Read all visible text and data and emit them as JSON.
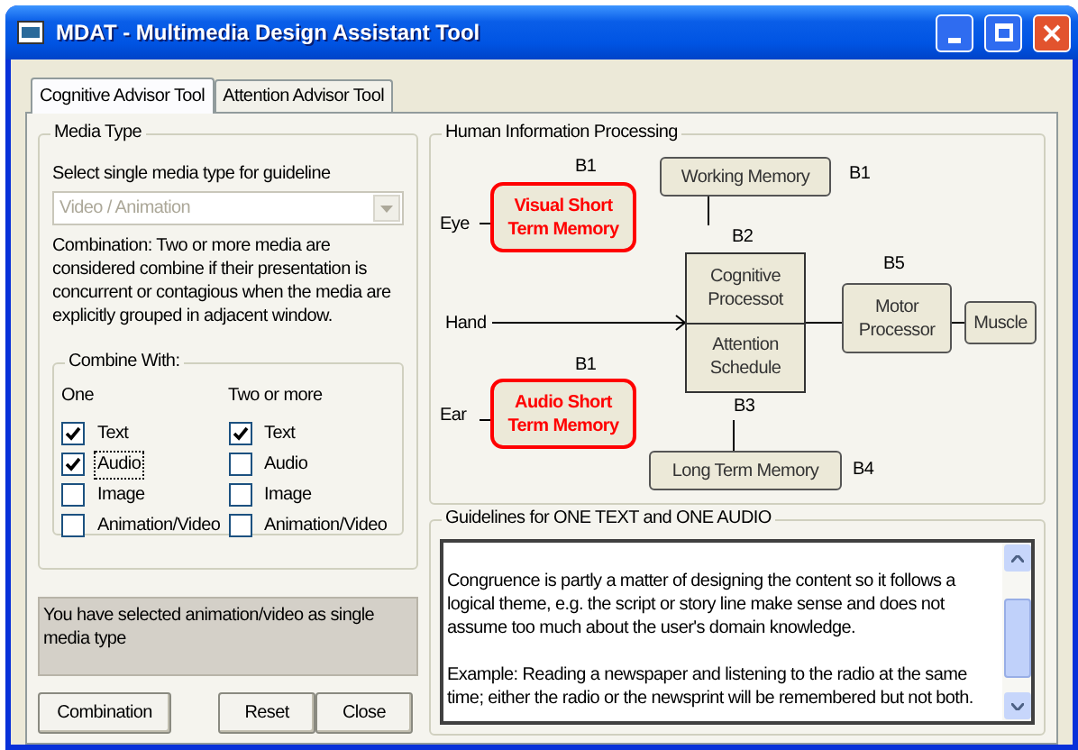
{
  "window": {
    "title": "MDAT - Multimedia Design Assistant Tool"
  },
  "tabs": [
    {
      "label": "Cognitive Advisor Tool",
      "selected": true
    },
    {
      "label": "Attention Advisor Tool",
      "selected": false
    }
  ],
  "media_type": {
    "title": "Media Type",
    "prompt": "Select single media type for guideline",
    "dropdown": {
      "value": "Video / Animation",
      "disabled": true
    },
    "description": "Combination: Two or more media are considered combine if their presentation is concurrent or contagious when the media are explicitly grouped in adjacent window.",
    "combine_with": {
      "title": "Combine With:",
      "columns": [
        {
          "heading": "One",
          "options": [
            {
              "label": "Text",
              "checked": true,
              "focused": false
            },
            {
              "label": "Audio",
              "checked": true,
              "focused": true
            },
            {
              "label": "Image",
              "checked": false,
              "focused": false
            },
            {
              "label": "Animation/Video",
              "checked": false,
              "focused": false
            }
          ]
        },
        {
          "heading": "Two or more",
          "options": [
            {
              "label": "Text",
              "checked": true,
              "focused": false
            },
            {
              "label": "Audio",
              "checked": false,
              "focused": false
            },
            {
              "label": "Image",
              "checked": false,
              "focused": false
            },
            {
              "label": "Animation/Video",
              "checked": false,
              "focused": false
            }
          ]
        }
      ]
    }
  },
  "status_message": "You have selected animation/video as single media type",
  "buttons": [
    "Combination",
    "Reset",
    "Close"
  ],
  "diagram": {
    "title": "Human Information Processing",
    "nodes": [
      {
        "kind": "box",
        "text": "Working Memory"
      },
      {
        "kind": "label",
        "text": "B1"
      },
      {
        "kind": "label",
        "text": "B1"
      },
      {
        "kind": "label",
        "text": "Eye"
      },
      {
        "kind": "sensory",
        "text": "Visual Short Term Memory"
      },
      {
        "kind": "label",
        "text": "B2"
      },
      {
        "kind": "split",
        "text": "Cognitive Processot",
        "text2": "Attention Schedule"
      },
      {
        "kind": "label",
        "text": "B5"
      },
      {
        "kind": "label",
        "text": "Hand"
      },
      {
        "kind": "box",
        "text": "Motor Processor"
      },
      {
        "kind": "box",
        "text": "Muscle"
      },
      {
        "kind": "label",
        "text": "B1"
      },
      {
        "kind": "label",
        "text": "Ear"
      },
      {
        "kind": "sensory",
        "text": "Audio Short Term Memory"
      },
      {
        "kind": "label",
        "text": "B3"
      },
      {
        "kind": "box",
        "text": "Long Term Memory"
      },
      {
        "kind": "label",
        "text": "B4"
      }
    ]
  },
  "guidelines": {
    "title": "Guidelines for ONE TEXT and ONE AUDIO",
    "paragraphs": [
      "Congruence is partly a matter of designing the content so it follows a logical theme, e.g. the script or story line make sense and does not assume too much about the user's domain knowledge.",
      "Example: Reading a newspaper and listening to the radio at the same time; either the radio or the newsprint will be remembered but not both."
    ]
  }
}
